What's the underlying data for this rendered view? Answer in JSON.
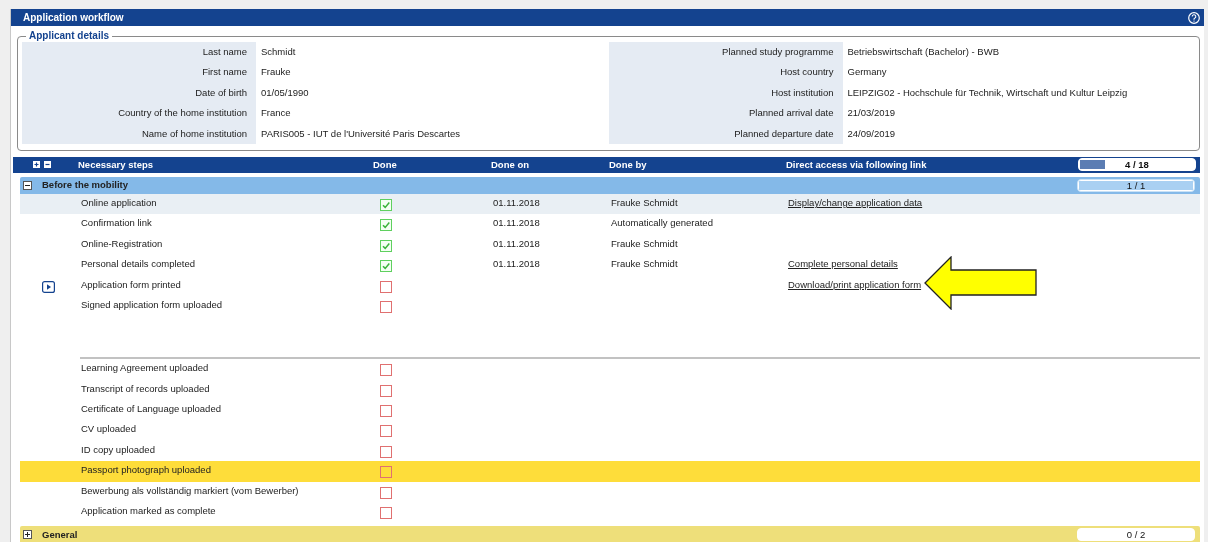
{
  "window": {
    "title": "Application workflow"
  },
  "applicant": {
    "legend": "Applicant details",
    "left": [
      {
        "label": "Last name",
        "value": "Schmidt"
      },
      {
        "label": "First name",
        "value": "Frauke"
      },
      {
        "label": "Date of birth",
        "value": "01/05/1990"
      },
      {
        "label": "Country of the home institution",
        "value": "France"
      },
      {
        "label": "Name of home institution",
        "value": "PARIS005 - IUT de l'Université Paris Descartes"
      }
    ],
    "right": [
      {
        "label": "Planned study programme",
        "value": "Betriebswirtschaft (Bachelor) - BWB"
      },
      {
        "label": "Host country",
        "value": "Germany"
      },
      {
        "label": "Host institution",
        "value": "LEIPZIG02 - Hochschule für Technik, Wirtschaft und Kultur Leipzig"
      },
      {
        "label": "Planned arrival date",
        "value": "21/03/2019"
      },
      {
        "label": "Planned departure date",
        "value": "24/09/2019"
      }
    ]
  },
  "steps": {
    "columns": [
      "Necessary steps",
      "Done",
      "Done on",
      "Done by",
      "Direct access via following link"
    ],
    "progress": {
      "text": "4 / 18",
      "level": 0.222
    },
    "groups": [
      {
        "title": "Before the mobility",
        "expanded": true,
        "color": "#84b9e8",
        "progress": {
          "text": "1 / 1",
          "level": 1
        },
        "sections": [
          [
            {
              "step": "Online application",
              "done": true,
              "done_on": "01.11.2018",
              "done_by": "Frauke Schmidt",
              "link": "Display/change application data",
              "current": false,
              "color": "#e9eff4"
            },
            {
              "step": "Confirmation link",
              "done": true,
              "done_on": "01.11.2018",
              "done_by": "Automatically generated",
              "current": false
            },
            {
              "step": "Online-Registration",
              "done": true,
              "done_on": "01.11.2018",
              "done_by": "Frauke Schmidt",
              "current": false
            },
            {
              "step": "Personal details completed",
              "done": true,
              "done_on": "01.11.2018",
              "done_by": "Frauke Schmidt",
              "link": "Complete personal details",
              "current": false
            },
            {
              "step": "Application form printed",
              "done": false,
              "link": "Download/print application form",
              "current": true
            },
            {
              "step": "Signed application form uploaded",
              "done": false,
              "current": false
            }
          ],
          [
            {
              "step": "Learning Agreement uploaded",
              "done": false,
              "current": false
            },
            {
              "step": "Transcript of records uploaded",
              "done": false,
              "current": false
            },
            {
              "step": "Certificate of Language uploaded",
              "done": false,
              "current": false
            },
            {
              "step": "CV uploaded",
              "done": false,
              "current": false
            },
            {
              "step": "ID copy uploaded",
              "done": false,
              "current": false
            },
            {
              "step": "Passport photograph uploaded",
              "done": false,
              "current": false,
              "color": "#fedd3a"
            },
            {
              "step": "Bewerbung als vollständig markiert (vom Bewerber)",
              "done": false,
              "current": false
            },
            {
              "step": "Application marked as complete",
              "done": false,
              "current": false
            }
          ]
        ]
      },
      {
        "title": "General",
        "expanded": false,
        "color": "#eedf7a",
        "progress": {
          "text": "0 / 2",
          "level": 0
        }
      }
    ]
  }
}
